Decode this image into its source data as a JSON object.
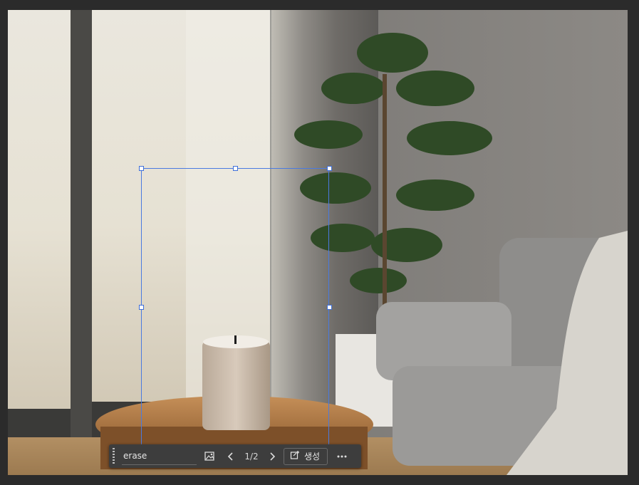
{
  "taskbar": {
    "prompt_value": "erase",
    "prompt_placeholder": "",
    "counter": "1/2",
    "generate_label": "생성",
    "icons": {
      "grip": "drag-handle-icon",
      "image": "reference-image-icon",
      "prev": "chevron-left-icon",
      "next": "chevron-right-icon",
      "generate": "generate-sparkle-icon",
      "more": "more-horizontal-icon"
    }
  },
  "colors": {
    "selection": "#4a7ae0",
    "taskbar_bg": "#3d3d3d",
    "workspace_bg": "#2b2b2b"
  }
}
